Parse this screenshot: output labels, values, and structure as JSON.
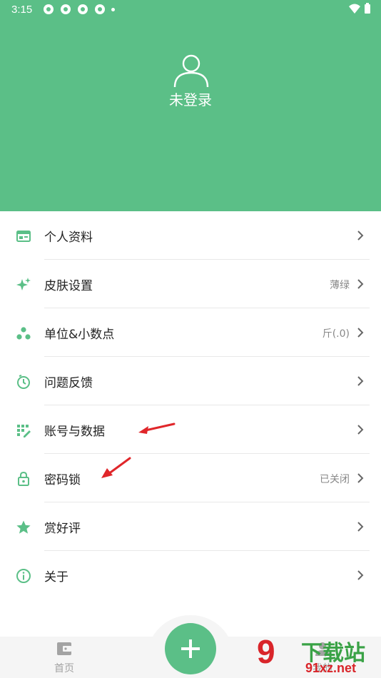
{
  "status_bar": {
    "time": "3:15"
  },
  "header": {
    "login_text": "未登录"
  },
  "menu": {
    "items": [
      {
        "label": "个人资料",
        "value": ""
      },
      {
        "label": "皮肤设置",
        "value": "薄绿"
      },
      {
        "label": "单位&小数点",
        "value": "斤(.0)"
      },
      {
        "label": "问题反馈",
        "value": ""
      },
      {
        "label": "账号与数据",
        "value": ""
      },
      {
        "label": "密码锁",
        "value": "已关闭"
      },
      {
        "label": "赏好评",
        "value": ""
      },
      {
        "label": "关于",
        "value": ""
      }
    ]
  },
  "bottom_nav": {
    "home_label": "首页",
    "right_label": "我的"
  },
  "watermark": {
    "number": "9",
    "title": "下载站",
    "domain": "91xz.net"
  },
  "colors": {
    "accent": "#5bbf87",
    "arrow": "#e0262a"
  }
}
